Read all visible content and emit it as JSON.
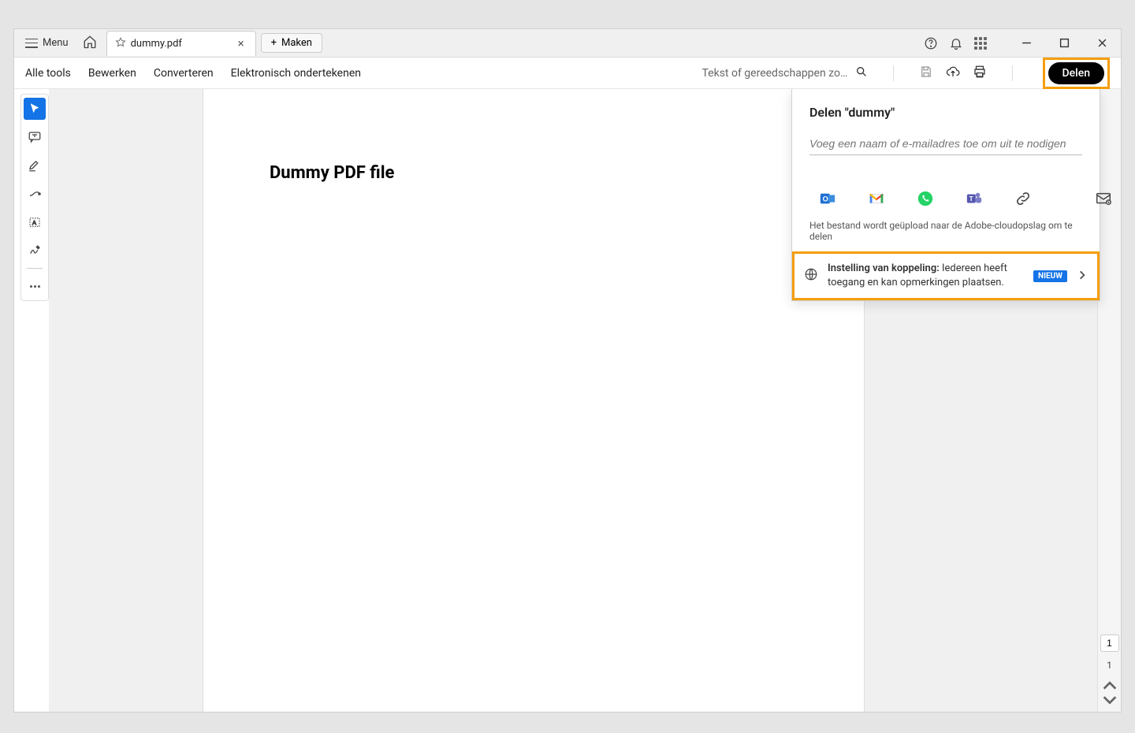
{
  "titlebar": {
    "menu_label": "Menu",
    "tab_title": "dummy.pdf",
    "create_label": "Maken"
  },
  "toolbar": {
    "items": [
      "Alle tools",
      "Bewerken",
      "Converteren",
      "Elektronisch ondertekenen"
    ],
    "search_placeholder": "Tekst of gereedschappen zoe...",
    "share_label": "Delen"
  },
  "document": {
    "heading": "Dummy PDF file"
  },
  "pager": {
    "current": "1",
    "total": "1"
  },
  "share_panel": {
    "title": "Delen \"dummy\"",
    "invite_placeholder": "Voeg een naam of e-mailadres toe om uit te nodigen",
    "upload_note": "Het bestand wordt geüpload naar de Adobe-cloudopslag om te delen",
    "link_setting_label": "Instelling van koppeling:",
    "link_setting_text": "Iedereen heeft toegang en kan opmerkingen plaatsen.",
    "new_badge": "NIEUW"
  }
}
